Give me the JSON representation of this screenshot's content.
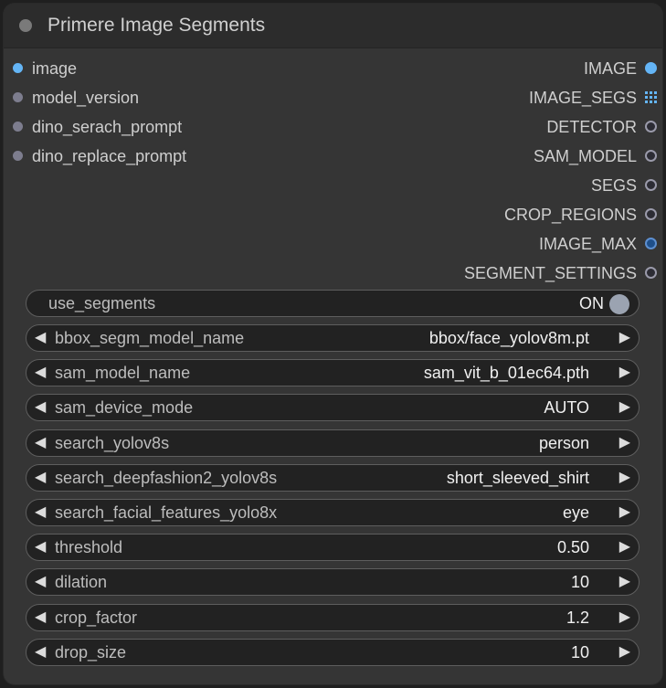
{
  "node": {
    "title": "Primere Image Segments"
  },
  "inputs": [
    {
      "label": "image",
      "type": "image"
    },
    {
      "label": "model_version",
      "type": "generic"
    },
    {
      "label": "dino_serach_prompt",
      "type": "generic"
    },
    {
      "label": "dino_replace_prompt",
      "type": "generic"
    }
  ],
  "outputs": [
    {
      "label": "IMAGE",
      "icon": "filled-blue-dot"
    },
    {
      "label": "IMAGE_SEGS",
      "icon": "grid-icon"
    },
    {
      "label": "DETECTOR",
      "icon": "hollow-dot"
    },
    {
      "label": "SAM_MODEL",
      "icon": "hollow-dot"
    },
    {
      "label": "SEGS",
      "icon": "hollow-dot"
    },
    {
      "label": "CROP_REGIONS",
      "icon": "hollow-dot"
    },
    {
      "label": "IMAGE_MAX",
      "icon": "filled-dark-blue-dot"
    },
    {
      "label": "SEGMENT_SETTINGS",
      "icon": "hollow-dot"
    }
  ],
  "widgets": {
    "use_segments": {
      "label": "use_segments",
      "value": "ON"
    },
    "combos": [
      {
        "label": "bbox_segm_model_name",
        "value": "bbox/face_yolov8m.pt"
      },
      {
        "label": "sam_model_name",
        "value": "sam_vit_b_01ec64.pth"
      },
      {
        "label": "sam_device_mode",
        "value": "AUTO"
      },
      {
        "label": "search_yolov8s",
        "value": "person"
      },
      {
        "label": "search_deepfashion2_yolov8s",
        "value": "short_sleeved_shirt"
      },
      {
        "label": "search_facial_features_yolo8x",
        "value": "eye"
      },
      {
        "label": "threshold",
        "value": "0.50"
      },
      {
        "label": "dilation",
        "value": "10"
      },
      {
        "label": "crop_factor",
        "value": "1.2"
      },
      {
        "label": "drop_size",
        "value": "10"
      }
    ],
    "arrow_left": "◀",
    "arrow_right": "▶"
  },
  "colors": {
    "image_slot": "#64b5f6",
    "generic_slot": "#7d7d8e",
    "node_bg": "#353535",
    "widget_bg": "#222222"
  }
}
